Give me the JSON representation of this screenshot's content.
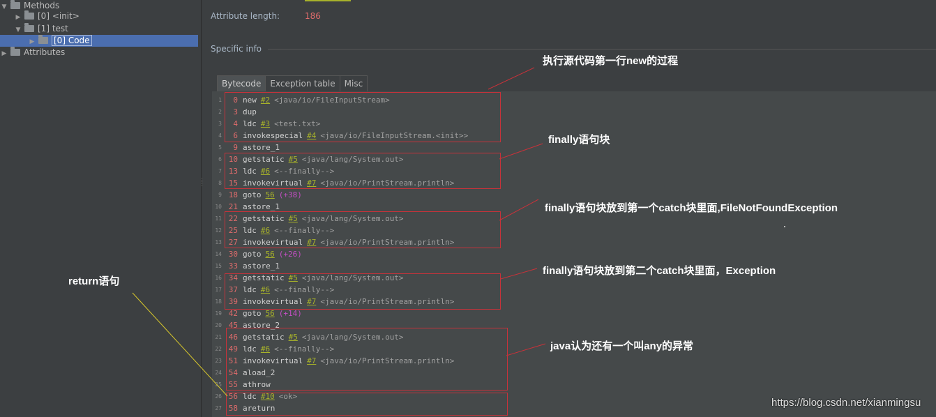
{
  "tree": {
    "methods_label": "Methods",
    "init_label": "[0] <init>",
    "test_label": "[1] test",
    "code_label": "[0] Code",
    "attributes_label": "Attributes"
  },
  "panel": {
    "attribute_length_label": "Attribute length:",
    "attribute_length_value": "186",
    "specific_info_label": "Specific info"
  },
  "tabs": [
    "Bytecode",
    "Exception table",
    "Misc"
  ],
  "bytecode": [
    {
      "line": "1",
      "offset": "0",
      "instr": "new",
      "ref": "#2",
      "comment": "<java/io/FileInputStream>"
    },
    {
      "line": "2",
      "offset": "3",
      "instr": "dup"
    },
    {
      "line": "3",
      "offset": "4",
      "instr": "ldc",
      "ref": "#3",
      "comment": "<test.txt>"
    },
    {
      "line": "4",
      "offset": "6",
      "instr": "invokespecial",
      "ref": "#4",
      "comment": "<java/io/FileInputStream.<init>>"
    },
    {
      "line": "5",
      "offset": "9",
      "instr": "astore_1"
    },
    {
      "line": "6",
      "offset": "10",
      "instr": "getstatic",
      "ref": "#5",
      "comment": "<java/lang/System.out>"
    },
    {
      "line": "7",
      "offset": "13",
      "instr": "ldc",
      "ref": "#6",
      "comment": "<--finally-->"
    },
    {
      "line": "8",
      "offset": "15",
      "instr": "invokevirtual",
      "ref": "#7",
      "comment": "<java/io/PrintStream.println>"
    },
    {
      "line": "9",
      "offset": "18",
      "instr": "goto",
      "target": "56",
      "delta": "(+38)"
    },
    {
      "line": "10",
      "offset": "21",
      "instr": "astore_1"
    },
    {
      "line": "11",
      "offset": "22",
      "instr": "getstatic",
      "ref": "#5",
      "comment": "<java/lang/System.out>"
    },
    {
      "line": "12",
      "offset": "25",
      "instr": "ldc",
      "ref": "#6",
      "comment": "<--finally-->"
    },
    {
      "line": "13",
      "offset": "27",
      "instr": "invokevirtual",
      "ref": "#7",
      "comment": "<java/io/PrintStream.println>"
    },
    {
      "line": "14",
      "offset": "30",
      "instr": "goto",
      "target": "56",
      "delta": "(+26)"
    },
    {
      "line": "15",
      "offset": "33",
      "instr": "astore_1"
    },
    {
      "line": "16",
      "offset": "34",
      "instr": "getstatic",
      "ref": "#5",
      "comment": "<java/lang/System.out>"
    },
    {
      "line": "17",
      "offset": "37",
      "instr": "ldc",
      "ref": "#6",
      "comment": "<--finally-->"
    },
    {
      "line": "18",
      "offset": "39",
      "instr": "invokevirtual",
      "ref": "#7",
      "comment": "<java/io/PrintStream.println>"
    },
    {
      "line": "19",
      "offset": "42",
      "instr": "goto",
      "target": "56",
      "delta": "(+14)"
    },
    {
      "line": "20",
      "offset": "45",
      "instr": "astore_2"
    },
    {
      "line": "21",
      "offset": "46",
      "instr": "getstatic",
      "ref": "#5",
      "comment": "<java/lang/System.out>"
    },
    {
      "line": "22",
      "offset": "49",
      "instr": "ldc",
      "ref": "#6",
      "comment": "<--finally-->"
    },
    {
      "line": "23",
      "offset": "51",
      "instr": "invokevirtual",
      "ref": "#7",
      "comment": "<java/io/PrintStream.println>"
    },
    {
      "line": "24",
      "offset": "54",
      "instr": "aload_2"
    },
    {
      "line": "25",
      "offset": "55",
      "instr": "athrow"
    },
    {
      "line": "26",
      "offset": "56",
      "instr": "ldc",
      "ref": "#10",
      "comment": "<ok>"
    },
    {
      "line": "27",
      "offset": "58",
      "instr": "areturn"
    }
  ],
  "annotations": {
    "new_process": "执行源代码第一行new的过程",
    "finally_block": "finally语句块",
    "finally_catch1": "finally语句块放到第一个catch块里面,FileNotFoundException",
    "finally_catch2": "finally语句块放到第二个catch块里面，Exception",
    "any_exception": "java认为还有一个叫any的异常",
    "return_stmt": "return语句"
  },
  "watermark": "https://blog.csdn.net/xianmingsu",
  "colors": {
    "background": "#3c3f41",
    "code_background": "#45494a",
    "offset": "#e06c6c",
    "reference": "#a7b22a",
    "delta": "#c34ec3",
    "box": "#c8323a",
    "selection": "#4b6eaf"
  }
}
